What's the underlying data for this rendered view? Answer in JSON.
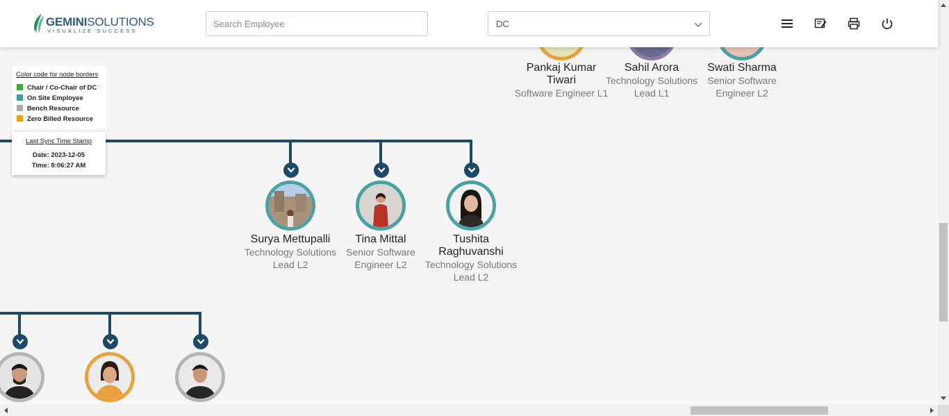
{
  "header": {
    "logo_main": "GEMINI",
    "logo_rest": "SOLUTIONS",
    "logo_tagline": "VISUALIZE SUCCESS",
    "search_placeholder": "Search Employee",
    "dc_select_value": "DC",
    "icons": [
      "menu-icon",
      "feedback-icon",
      "print-icon",
      "power-icon"
    ]
  },
  "legend": {
    "title": "Color code for node borders",
    "items": [
      {
        "label": "Chair / Co-Chair of DC",
        "color": "#2db52d"
      },
      {
        "label": "On Site Employee",
        "color": "#3aa0a0"
      },
      {
        "label": "Bench Resource",
        "color": "#a9a9a9"
      },
      {
        "label": "Zero Billed Resource",
        "color": "#f0a010"
      }
    ]
  },
  "sync": {
    "title": "Last Sync Time Stamp",
    "date": "Date: 2023-12-05",
    "time": "Time: 8:06:27 AM"
  },
  "colors": {
    "connector": "#1e4868",
    "onsite_border": "#4aa3a3"
  },
  "top_nodes": [
    {
      "name": "Pankaj Kumar Tiwari",
      "role": "Software Engineer L1"
    },
    {
      "name": "Sahil Arora",
      "role": "Technology Solutions Lead L1"
    },
    {
      "name": "Swati Sharma",
      "role": "Senior Software Engineer L2"
    }
  ],
  "middle_nodes": [
    {
      "name": "Surya Mettupalli",
      "role": "Technology Solutions Lead L2"
    },
    {
      "name": "Tina Mittal",
      "role": "Senior Software Engineer L2"
    },
    {
      "name": "Tushita Raghuvanshi",
      "role": "Technology Solutions Lead L2"
    }
  ]
}
